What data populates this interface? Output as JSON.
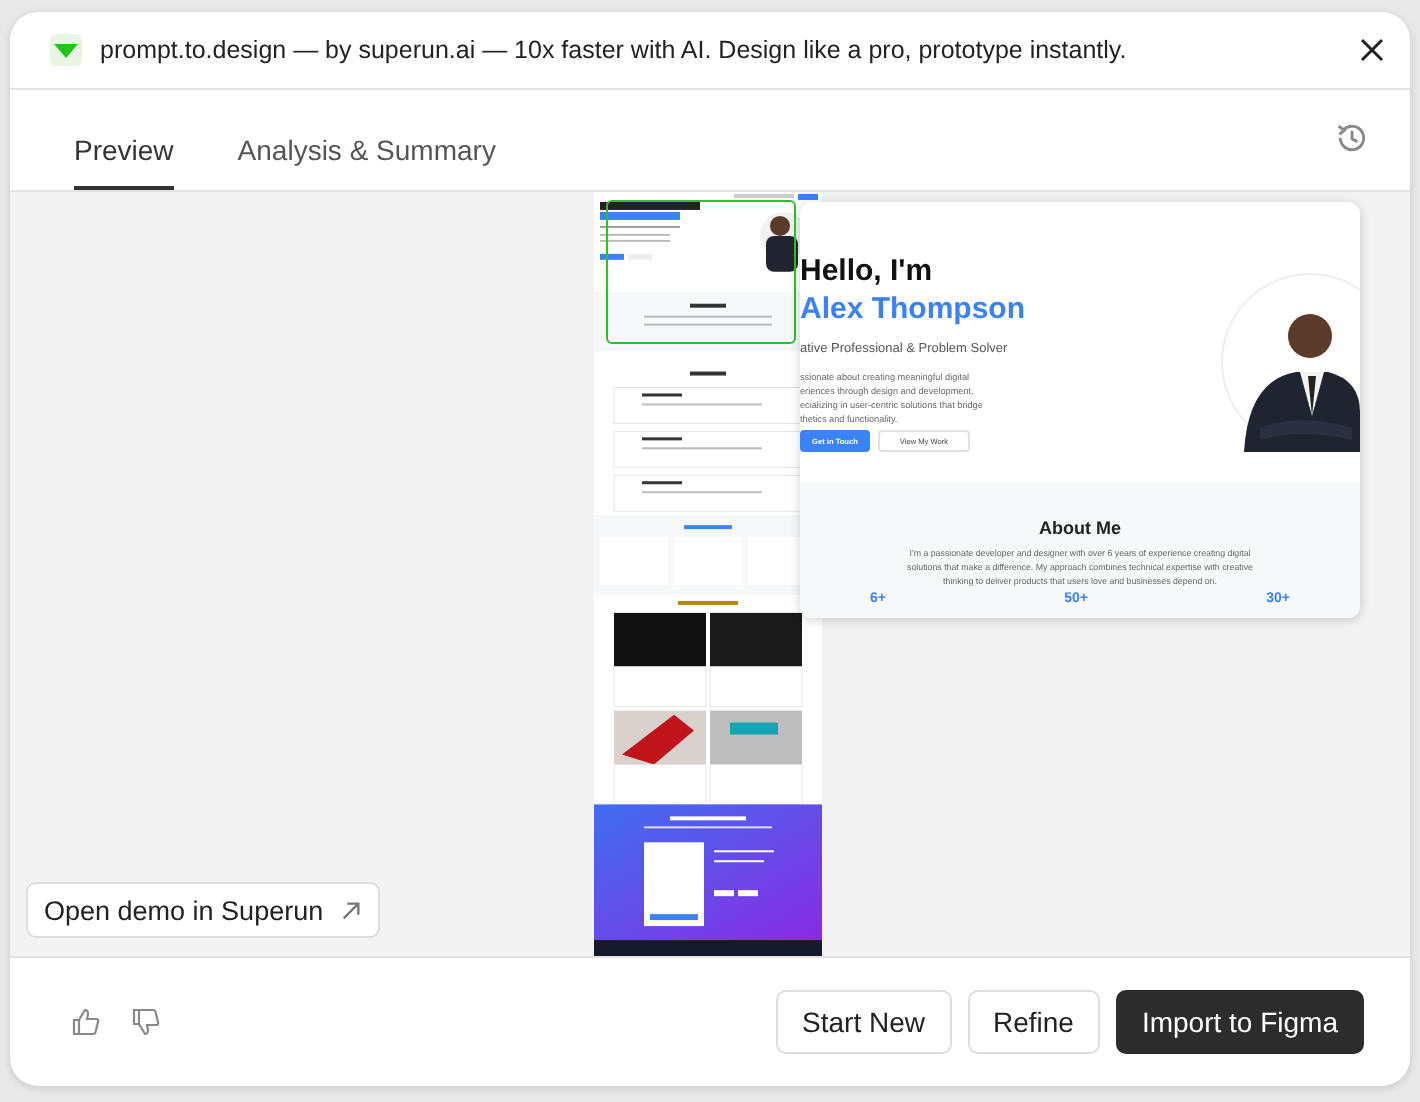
{
  "window": {
    "title": "prompt.to.design — by superun.ai — 10x faster with AI. Design like a pro, prototype instantly."
  },
  "tabs": [
    {
      "label": "Preview",
      "selected": true
    },
    {
      "label": "Analysis & Summary",
      "selected": false
    }
  ],
  "magnifier": {
    "greeting": "Hello, I'm",
    "name": "Alex Thompson",
    "subtitle": "ative Professional & Problem Solver",
    "intro": [
      "ssionate about creating meaningful digital",
      "eriences through design and development.",
      "ecializing in user-centric solutions that bridge",
      "thetics and functionality."
    ],
    "buttons": [
      {
        "label": "Get in Touch",
        "kind": "primary"
      },
      {
        "label": "View My Work",
        "kind": "outline"
      }
    ],
    "about_title": "About Me",
    "about_text": "I'm a passionate developer and designer with over 6 years of experience creating digital solutions that make a difference. My approach combines technical expertise with creative thinking to deliver products that users love and businesses depend on.",
    "stats": [
      "6+",
      "50+",
      "30+"
    ]
  },
  "open_demo": {
    "label": "Open demo in Superun"
  },
  "buttons": [
    {
      "label": "Start New",
      "kind": "secondary"
    },
    {
      "label": "Refine",
      "kind": "secondary"
    },
    {
      "label": "Import to Figma",
      "kind": "primary"
    }
  ]
}
